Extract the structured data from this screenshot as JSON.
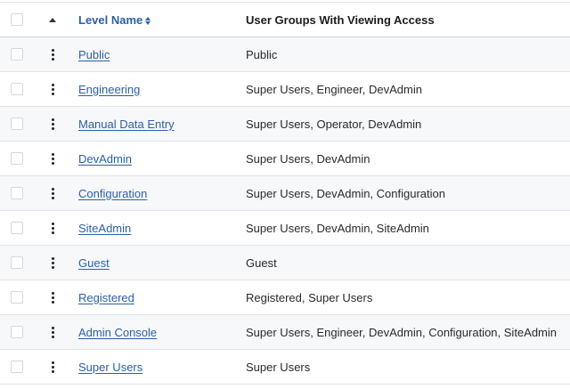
{
  "header": {
    "level_name": "Level Name",
    "user_groups": "User Groups With Viewing Access"
  },
  "rows": [
    {
      "name": "Public",
      "groups": "Public"
    },
    {
      "name": "Engineering",
      "groups": "Super Users, Engineer, DevAdmin"
    },
    {
      "name": "Manual Data Entry",
      "groups": "Super Users, Operator, DevAdmin"
    },
    {
      "name": "DevAdmin",
      "groups": "Super Users, DevAdmin"
    },
    {
      "name": "Configuration",
      "groups": "Super Users, DevAdmin, Configuration"
    },
    {
      "name": "SiteAdmin",
      "groups": "Super Users, DevAdmin, SiteAdmin"
    },
    {
      "name": "Guest",
      "groups": "Guest"
    },
    {
      "name": "Registered",
      "groups": "Registered, Super Users"
    },
    {
      "name": "Admin Console",
      "groups": "Super Users, Engineer, DevAdmin, Configuration, SiteAdmin"
    },
    {
      "name": "Super Users",
      "groups": "Super Users"
    }
  ],
  "icons": {
    "ordering_header": "sort-ascending-icon",
    "row_handle": "drag-handle-icon",
    "name_sort": "sort-both-icon"
  },
  "colors": {
    "link": "#2b5fa8",
    "row_stripe": "#f7f8fa",
    "border": "#dfe3e8"
  }
}
